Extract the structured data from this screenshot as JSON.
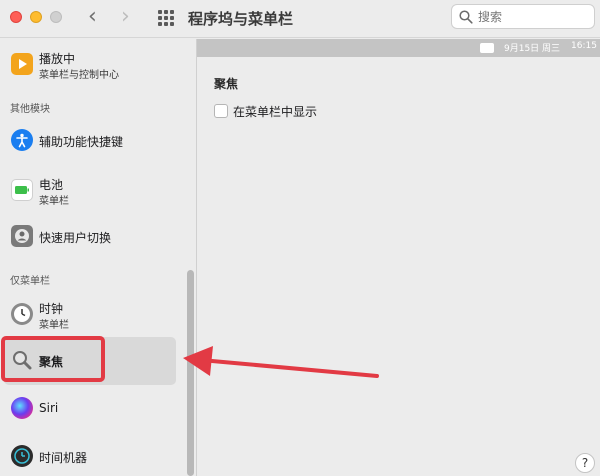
{
  "window": {
    "title": "程序坞与菜单栏",
    "search_placeholder": "搜索",
    "nav": {
      "back": "‹",
      "forward": "›"
    }
  },
  "sidebar": {
    "items": [
      {
        "label": "播放中",
        "sublabel": "菜单栏与控制中心",
        "icon": "play-icon",
        "color": "#f3a41c"
      },
      {
        "label": "辅助功能快捷键",
        "icon": "accessibility-icon",
        "color": "#1a7ef0"
      },
      {
        "label": "电池",
        "sublabel": "菜单栏",
        "icon": "battery-icon",
        "color": "#3cbf4a"
      },
      {
        "label": "快速用户切换",
        "icon": "user-switch-icon",
        "color": "#7a7a7a"
      },
      {
        "label": "时钟",
        "sublabel": "菜单栏",
        "icon": "clock-icon",
        "color": "#8a8a8a"
      },
      {
        "label": "聚焦",
        "icon": "spotlight-icon",
        "color": "#6e6e6e",
        "selected": true
      },
      {
        "label": "Siri",
        "icon": "siri-icon",
        "color": "#5a3df0"
      },
      {
        "label": "时间机器",
        "icon": "time-machine-icon",
        "color": "#2b2b2b"
      }
    ],
    "sections": {
      "other_modules": "其他模块",
      "menubar_only": "仅菜单栏"
    }
  },
  "content": {
    "menubar_preview": {
      "date": "9月15日 周三",
      "time": "16:15"
    },
    "section_title": "聚焦",
    "checkbox_label": "在菜单栏中显示",
    "checkbox_checked": false,
    "help": "?"
  },
  "annotation": {
    "highlight_color": "#e23a44"
  }
}
